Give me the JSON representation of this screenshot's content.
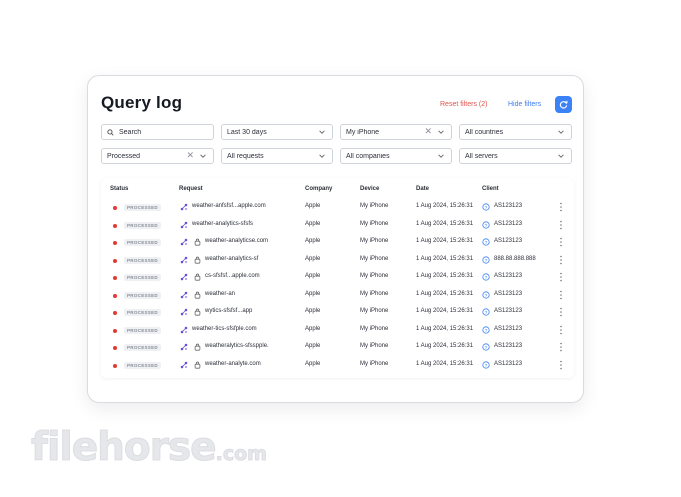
{
  "title": "Query log",
  "actions": {
    "reset_filters": "Reset filters (2)",
    "hide_filters": "Hide filters"
  },
  "filters": {
    "search_placeholder": "Search",
    "time": "Last 30 days",
    "device": "My iPhone",
    "countries": "All countries",
    "status": "Processed",
    "requests": "All requests",
    "companies": "All companies",
    "servers": "All servers"
  },
  "columns": [
    "Status",
    "Request",
    "Company",
    "Device",
    "Date",
    "Client"
  ],
  "rows": [
    {
      "status": "PROCESSED",
      "request": "weather-anfsfsf...apple.com",
      "lock": false,
      "company": "Apple",
      "device": "My iPhone",
      "date": "1 Aug 2024, 15:26:31",
      "client": "AS123123"
    },
    {
      "status": "PROCESSED",
      "request": "weather-analytics-sfsfs",
      "lock": false,
      "company": "Apple",
      "device": "My iPhone",
      "date": "1 Aug 2024, 15:26:31",
      "client": "AS123123"
    },
    {
      "status": "PROCESSED",
      "request": "weather-analyticse.com",
      "lock": true,
      "company": "Apple",
      "device": "My iPhone",
      "date": "1 Aug 2024, 15:26:31",
      "client": "AS123123"
    },
    {
      "status": "PROCESSED",
      "request": "weather-analytics-sf",
      "lock": true,
      "company": "Apple",
      "device": "My iPhone",
      "date": "1 Aug 2024, 15:26:31",
      "client": "888.88.888.888"
    },
    {
      "status": "PROCESSED",
      "request": "cs-sfsfsf...apple.com",
      "lock": true,
      "company": "Apple",
      "device": "My iPhone",
      "date": "1 Aug 2024, 15:26:31",
      "client": "AS123123"
    },
    {
      "status": "PROCESSED",
      "request": "weather-an",
      "lock": true,
      "company": "Apple",
      "device": "My iPhone",
      "date": "1 Aug 2024, 15:26:31",
      "client": "AS123123"
    },
    {
      "status": "PROCESSED",
      "request": "wytics-sfsfsf...app",
      "lock": true,
      "company": "Apple",
      "device": "My iPhone",
      "date": "1 Aug 2024, 15:26:31",
      "client": "AS123123"
    },
    {
      "status": "PROCESSED",
      "request": "weather-tics-sfsfple.com",
      "lock": false,
      "company": "Apple",
      "device": "My iPhone",
      "date": "1 Aug 2024, 15:26:31",
      "client": "AS123123"
    },
    {
      "status": "PROCESSED",
      "request": "weatheralytics-sfsspple.",
      "lock": true,
      "company": "Apple",
      "device": "My iPhone",
      "date": "1 Aug 2024, 15:26:31",
      "client": "AS123123"
    },
    {
      "status": "PROCESSED",
      "request": "weather-analyte.com",
      "lock": true,
      "company": "Apple",
      "device": "My iPhone",
      "date": "1 Aug 2024, 15:26:31",
      "client": "AS123123"
    }
  ],
  "watermark": {
    "brand": "filehorse",
    "tld": ".com"
  },
  "colors": {
    "accent": "#3b82f6",
    "danger": "#e53935",
    "request_icon": "#6a4fd8"
  }
}
